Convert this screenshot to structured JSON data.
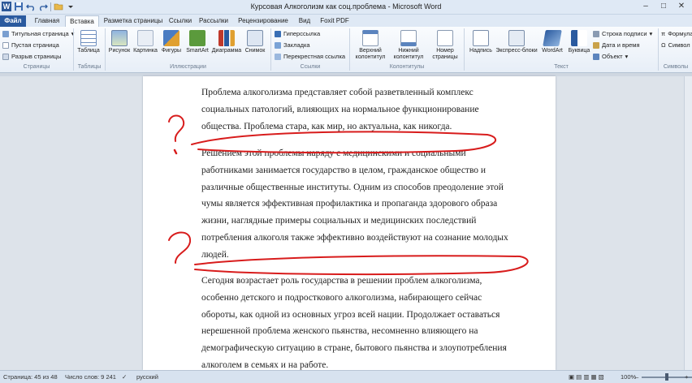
{
  "window": {
    "title": "Курсовая Алкоголизм как соц.проблема  -  Microsoft Word",
    "controls": [
      "–",
      "□",
      "✕"
    ]
  },
  "tabs": [
    {
      "label": "Файл"
    },
    {
      "label": "Главная"
    },
    {
      "label": "Вставка"
    },
    {
      "label": "Разметка страницы"
    },
    {
      "label": "Ссылки"
    },
    {
      "label": "Рассылки"
    },
    {
      "label": "Рецензирование"
    },
    {
      "label": "Вид"
    },
    {
      "label": "Foxit PDF"
    }
  ],
  "ribbon": {
    "pages_group": {
      "label": "Страницы",
      "items": [
        "Титульная страница",
        "Пустая страница",
        "Разрыв страницы"
      ]
    },
    "tables_group": {
      "label": "Таблицы",
      "table": "Таблица"
    },
    "illustrations_group": {
      "label": "Иллюстрации",
      "items": [
        "Рисунок",
        "Картинка",
        "Фигуры",
        "SmartArt",
        "Диаграмма",
        "Снимок"
      ]
    },
    "links_group": {
      "label": "Ссылки",
      "items": [
        "Гиперссылка",
        "Закладка",
        "Перекрестная ссылка"
      ]
    },
    "header_footer_group": {
      "label": "Колонтитулы",
      "header": [
        "Верхний",
        "колонтитул"
      ],
      "footer": [
        "Нижний",
        "колонтитул"
      ],
      "page_number": [
        "Номер",
        "страницы"
      ]
    },
    "text_group": {
      "label": "Текст",
      "items": [
        "Надпись",
        "Экспресс-блоки",
        "WordArt",
        "Буквица"
      ],
      "small": [
        "Строка подписи",
        "Дата и время",
        "Объект"
      ]
    },
    "symbols_group": {
      "label": "Символы",
      "items": [
        "Формула",
        "Символ"
      ]
    }
  },
  "document": {
    "paragraphs": [
      {
        "lines": [
          "Проблема алкоголизма представляет собой разветвленный комплекс",
          "социальных патологий, влияющих на нормальное функционирование",
          "общества. Проблема стара, как мир, но актуальна, как никогда."
        ]
      },
      {
        "lines": [
          "Решением этой проблемы наряду с медицинскими и социальными",
          "работниками занимается государство в целом, гражданское общество и",
          "различные общественные институты. Одним из способов преодоление этой",
          "чумы является эффективная профилактика и пропаганда здорового образа",
          "жизни, наглядные примеры социальных и медицинских последствий",
          "потребления алкоголя также эффективно воздействуют на сознание молодых",
          "людей."
        ]
      },
      {
        "lines": [
          "Сегодня возрастает роль государства в решении проблем алкоголизма,",
          "особенно детского и подросткового алкоголизма, набирающего сейчас",
          "обороты, как одной из основных угроз всей нации. Продолжает оставаться",
          "нерешенной проблема женского пьянства, несомненно влияющего на",
          "демографическую ситуацию в стране, бытового пьянства и злоупотребления",
          "алкоголем в семьях и на работе."
        ]
      }
    ],
    "annotation_color": "#d81c1c"
  },
  "statusbar": {
    "page": "Страница: 45 из 48",
    "words": "Число слов: 9 241",
    "language": "русский",
    "zoom": "100%",
    "zoom_fraction": 0.5
  },
  "colors": {
    "file_tab": "#2a5a9f",
    "ribbon_bg": "#eef3f9",
    "page_bg": "#ffffff"
  }
}
